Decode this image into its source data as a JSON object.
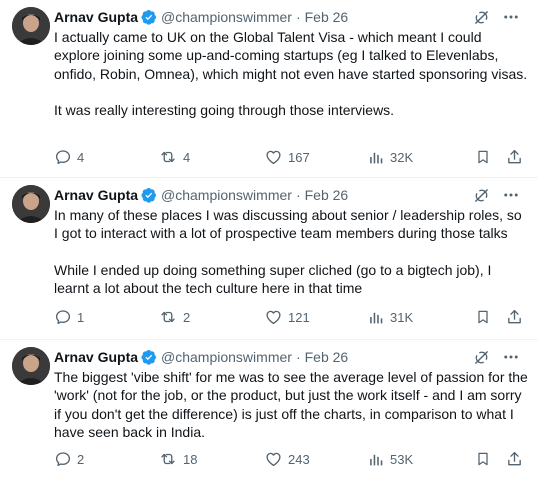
{
  "tweets": [
    {
      "name": "Arnav Gupta",
      "handle": "@championswimmer",
      "separator": "·",
      "date": "Feb 26",
      "paragraphs": [
        "I actually came to UK on the Global Talent Visa - which meant I could explore joining some up-and-coming startups (eg I talked to Elevenlabs, onfido, Robin, Omnea), which might not even have started sponsoring visas.",
        "It was really interesting going through those interviews."
      ],
      "replies": "4",
      "reposts": "4",
      "likes": "167",
      "views": "32K"
    },
    {
      "name": "Arnav Gupta",
      "handle": "@championswimmer",
      "separator": "·",
      "date": "Feb 26",
      "paragraphs": [
        "In many of these places I was discussing about senior / leadership roles, so I got to interact with a lot of prospective team members during those talks",
        "While I ended up doing something super cliched (go to a bigtech job), I learnt a lot about the tech culture here in that time"
      ],
      "replies": "1",
      "reposts": "2",
      "likes": "121",
      "views": "31K"
    },
    {
      "name": "Arnav Gupta",
      "handle": "@championswimmer",
      "separator": "·",
      "date": "Feb 26",
      "paragraphs": [
        "The biggest 'vibe shift' for me was to see the average level of passion for the 'work' (not for the job, or the product, but just the work itself - and I am sorry if you don't get the difference) is just off the charts, in comparison to what I have seen back in India."
      ],
      "replies": "2",
      "reposts": "18",
      "likes": "243",
      "views": "53K"
    }
  ],
  "icons": {
    "verified": "verified-badge-icon",
    "grok": "grok-icon",
    "more": "more-icon",
    "reply": "reply-icon",
    "repost": "repost-icon",
    "like": "like-icon",
    "views": "views-icon",
    "bookmark": "bookmark-icon",
    "share": "share-icon"
  },
  "colors": {
    "text": "#0f1419",
    "secondary": "#536471",
    "verified": "#1d9bf0",
    "divider": "#eff3f4"
  }
}
